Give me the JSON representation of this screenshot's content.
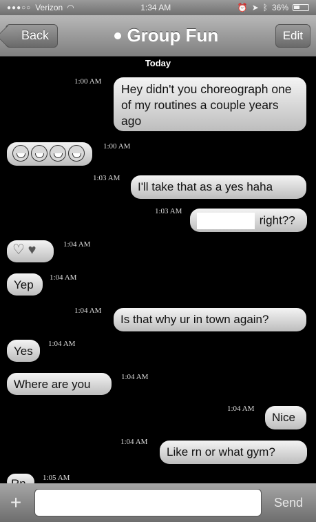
{
  "status_bar": {
    "carrier": "Verizon",
    "time": "1:34 AM",
    "battery": "36%"
  },
  "nav": {
    "back_label": "Back",
    "title": "Group Fun",
    "edit_label": "Edit"
  },
  "conversation": {
    "day": "Today",
    "messages": [
      {
        "time": "1:00 AM",
        "text": "Hey didn't you choreograph one of my routines a couple years ago"
      },
      {
        "time": "1:00 AM",
        "emoji": [
          "laughing-face",
          "laughing-face",
          "laughing-face",
          "laughing-face"
        ]
      },
      {
        "time": "1:03 AM",
        "text": "I'll take that as a yes haha"
      },
      {
        "time": "1:03 AM",
        "text": "right??"
      },
      {
        "time": "1:04 AM",
        "emoji": [
          "heart",
          "heart"
        ]
      },
      {
        "time": "1:04 AM",
        "text": "Yep"
      },
      {
        "time": "1:04 AM",
        "text": "Is that why ur in town again?"
      },
      {
        "time": "1:04 AM",
        "text": "Yes"
      },
      {
        "time": "1:04 AM",
        "text": "Where are you"
      },
      {
        "time": "1:04 AM",
        "text": "Nice"
      },
      {
        "time": "1:04 AM",
        "text": "Like rn or what gym?"
      },
      {
        "time": "1:05 AM",
        "text": "Rn"
      }
    ]
  },
  "input_bar": {
    "add_label": "+",
    "send_label": "Send",
    "message_value": ""
  }
}
